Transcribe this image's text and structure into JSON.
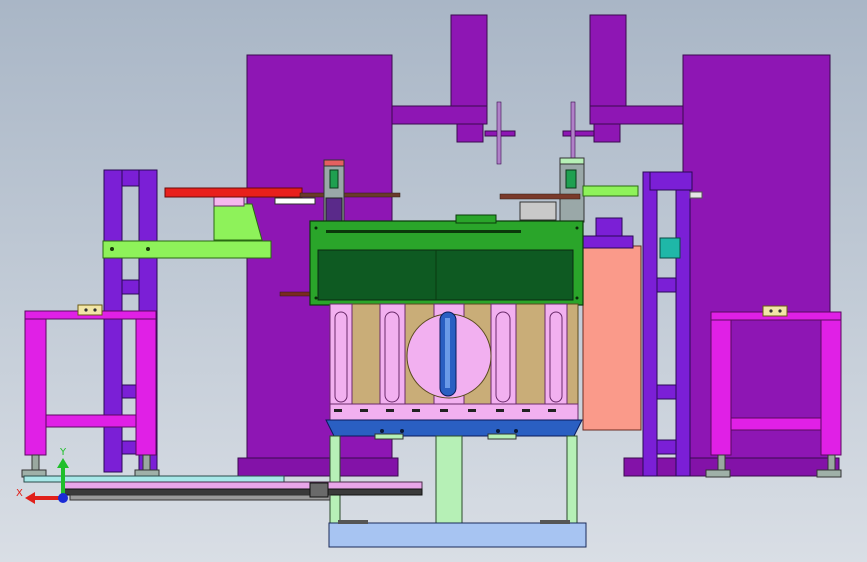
{
  "viewport": {
    "background_top": "#a9b6c6",
    "background_bottom": "#d9dee5"
  },
  "triad": {
    "x_label": "X",
    "y_label": "Y",
    "x_color": "#e0201a",
    "y_color": "#1fbf2a",
    "z_color": "#1a2bd6"
  },
  "colors": {
    "press_frame": "#8e16b4",
    "left_tower": "#7b1fd6",
    "magenta_stand": "#e020e6",
    "green_housing": "#2aa52a",
    "green_window": "#0e5a22",
    "pink_plates": "#f2b0f0",
    "tan_plates": "#c9ad78",
    "blue_base": "#2a5fc2",
    "light_green_column": "#b6f0b6",
    "salmon_panel": "#fa9a8a",
    "red_arm": "#e8201c",
    "lime_rail": "#8ef25a",
    "light_blue_frame": "#a7c4f2"
  }
}
